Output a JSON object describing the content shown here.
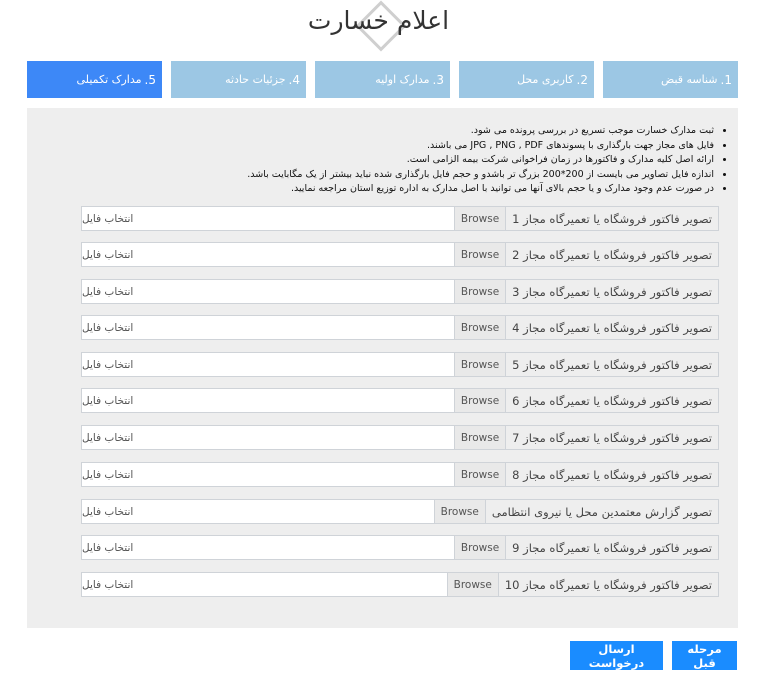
{
  "title": "اعلام خسارت",
  "steps": [
    {
      "num": "1.",
      "label": "شناسه قبض",
      "active": false
    },
    {
      "num": "2.",
      "label": "کاربری محل",
      "active": false
    },
    {
      "num": "3.",
      "label": "مدارک اولیه",
      "active": false
    },
    {
      "num": "4.",
      "label": "جزئیات حادثه",
      "active": false
    },
    {
      "num": "5.",
      "label": "مدارک تکمیلی",
      "active": true
    }
  ],
  "notes": [
    "ثبت مدارک خسارت موجب تسریع در بررسی پرونده می شود.",
    "فایل های مجاز جهت بارگذاری با پسوندهای JPG , PNG , PDF می باشند.",
    "ارائه اصل کلیه مدارک و فاکتورها در زمان فراخوانی شرکت بیمه الزامی است.",
    "اندازه فایل تصاویر می بایست از 200*200 بزرگ تر باشدو و حجم فایل بارگذاری شده نباید بیشتر از یک مگابایت باشد.",
    "در صورت عدم وجود مدارک و یا حجم بالای آنها می توانید با اصل مدارک به اداره توزیع استان مراجعه نمایید."
  ],
  "file_rows": [
    {
      "label": "تصویر فاکتور فروشگاه یا تعمیرگاه مجاز 1",
      "browse": "Browse",
      "placeholder": "انتخاب فایل"
    },
    {
      "label": "تصویر فاکتور فروشگاه یا تعمیرگاه مجاز 2",
      "browse": "Browse",
      "placeholder": "انتخاب فایل"
    },
    {
      "label": "تصویر فاکتور فروشگاه یا تعمیرگاه مجاز 3",
      "browse": "Browse",
      "placeholder": "انتخاب فایل"
    },
    {
      "label": "تصویر فاکتور فروشگاه یا تعمیرگاه مجاز 4",
      "browse": "Browse",
      "placeholder": "انتخاب فایل"
    },
    {
      "label": "تصویر فاکتور فروشگاه یا تعمیرگاه مجاز 5",
      "browse": "Browse",
      "placeholder": "انتخاب فایل"
    },
    {
      "label": "تصویر فاکتور فروشگاه یا تعمیرگاه مجاز 6",
      "browse": "Browse",
      "placeholder": "انتخاب فایل"
    },
    {
      "label": "تصویر فاکتور فروشگاه یا تعمیرگاه مجاز 7",
      "browse": "Browse",
      "placeholder": "انتخاب فایل"
    },
    {
      "label": "تصویر فاکتور فروشگاه یا تعمیرگاه مجاز 8",
      "browse": "Browse",
      "placeholder": "انتخاب فایل"
    },
    {
      "label": "تصویر گزارش معتمدین محل یا نیروی انتظامی",
      "browse": "Browse",
      "placeholder": "انتخاب فایل"
    },
    {
      "label": "تصویر فاکتور فروشگاه یا تعمیرگاه مجاز 9",
      "browse": "Browse",
      "placeholder": "انتخاب فایل"
    },
    {
      "label": "تصویر فاکتور فروشگاه یا تعمیرگاه مجاز 10",
      "browse": "Browse",
      "placeholder": "انتخاب فایل"
    }
  ],
  "buttons": {
    "previous": "مرحله قبل",
    "submit": "ارسال درخواست"
  },
  "colors": {
    "step_inactive": "#9cc7e4",
    "step_active": "#3d88f7",
    "button": "#1a8cff",
    "panel": "#eeeeee"
  }
}
